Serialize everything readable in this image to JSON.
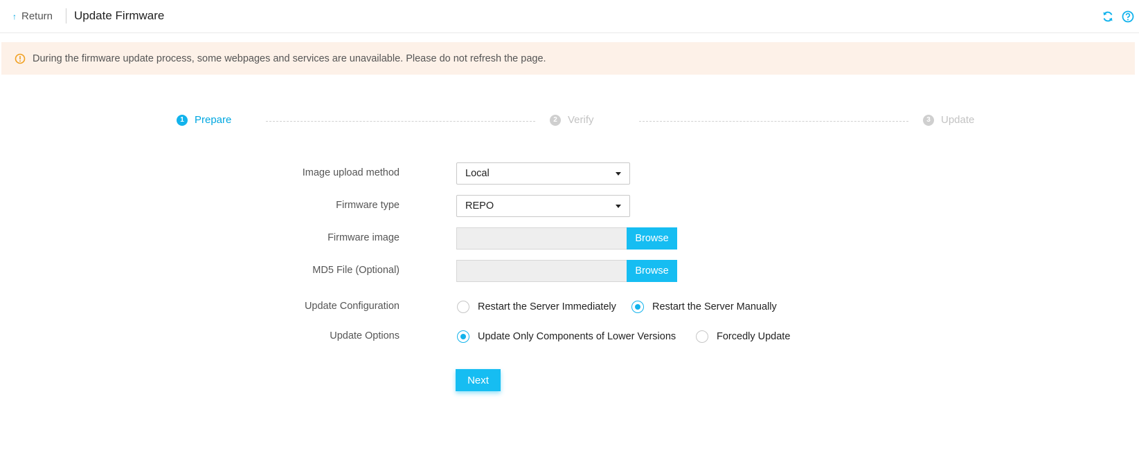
{
  "header": {
    "return_label": "Return",
    "title": "Update Firmware"
  },
  "banner": {
    "message": "During the firmware update process, some webpages and services are unavailable. Please do not refresh the page."
  },
  "steps": [
    {
      "num": "1",
      "label": "Prepare",
      "state": "active"
    },
    {
      "num": "2",
      "label": "Verify",
      "state": "inactive"
    },
    {
      "num": "3",
      "label": "Update",
      "state": "inactive"
    }
  ],
  "form": {
    "upload_method": {
      "label": "Image upload method",
      "value": "Local"
    },
    "firmware_type": {
      "label": "Firmware type",
      "value": "REPO"
    },
    "firmware_image": {
      "label": "Firmware image",
      "value": "",
      "button": "Browse"
    },
    "md5_file": {
      "label": "MD5 File (Optional)",
      "value": "",
      "button": "Browse"
    },
    "update_config": {
      "label": "Update Configuration",
      "options": [
        "Restart the Server Immediately",
        "Restart the Server Manually"
      ],
      "selected": "Restart the Server Manually"
    },
    "update_options": {
      "label": "Update Options",
      "options": [
        "Update Only Components of Lower Versions",
        "Forcedly Update"
      ],
      "selected": "Update Only Components of Lower Versions"
    },
    "next_label": "Next"
  },
  "colors": {
    "accent": "#16bdf2",
    "banner_bg": "#fdf1e8",
    "warning": "#f0a020"
  },
  "icons": {
    "return": "return-arrow-icon",
    "refresh": "refresh-icon",
    "help": "help-icon",
    "warning": "warning-icon"
  }
}
